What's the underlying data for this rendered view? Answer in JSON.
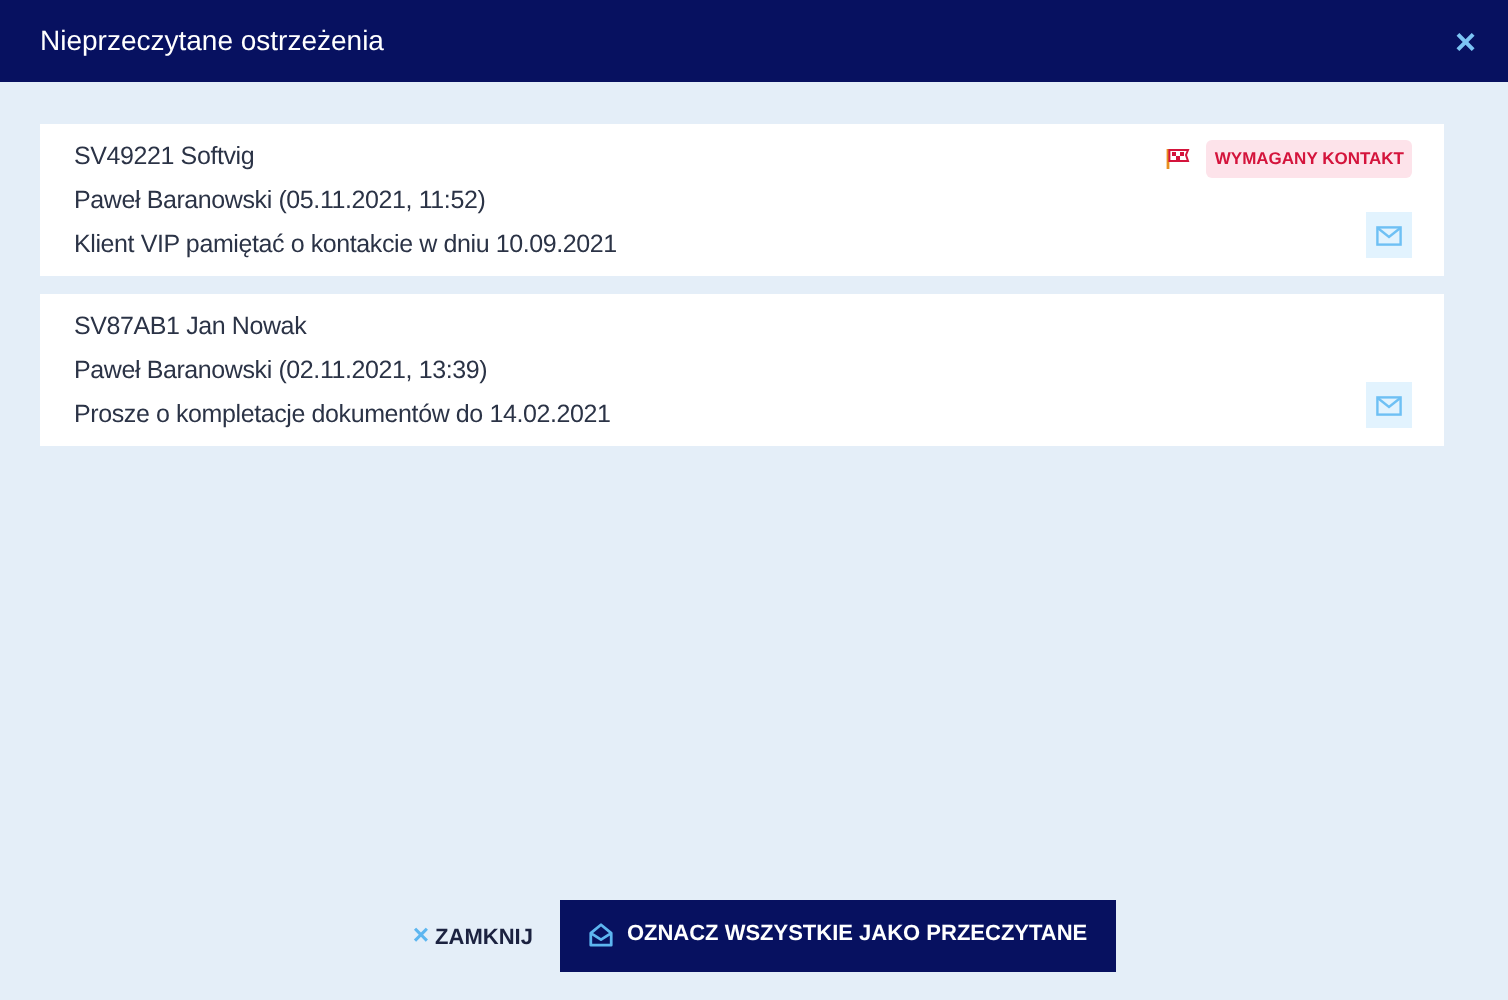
{
  "window": {
    "title": "Nieprzeczytane ostrzeżenia",
    "close": "×"
  },
  "alerts": [
    {
      "title": "SV49221 Softvig",
      "author": "Paweł Baranowski (05.11.2021, 11:52)",
      "message": "Klient VIP pamiętać o kontakcie w dniu 10.09.2021",
      "tag": "WYMAGANY KONTAKT"
    },
    {
      "title": "SV87AB1 Jan Nowak",
      "author": "Paweł Baranowski (02.11.2021, 13:39)",
      "message": "Prosze o kompletacje dokumentów do 14.02.2021"
    }
  ],
  "buttons": {
    "close": "ZAMKNIJ",
    "close_icon": "×",
    "mark_all": "OZNACZ WSZYSTKIE JAKO PRZECZYTANE"
  }
}
